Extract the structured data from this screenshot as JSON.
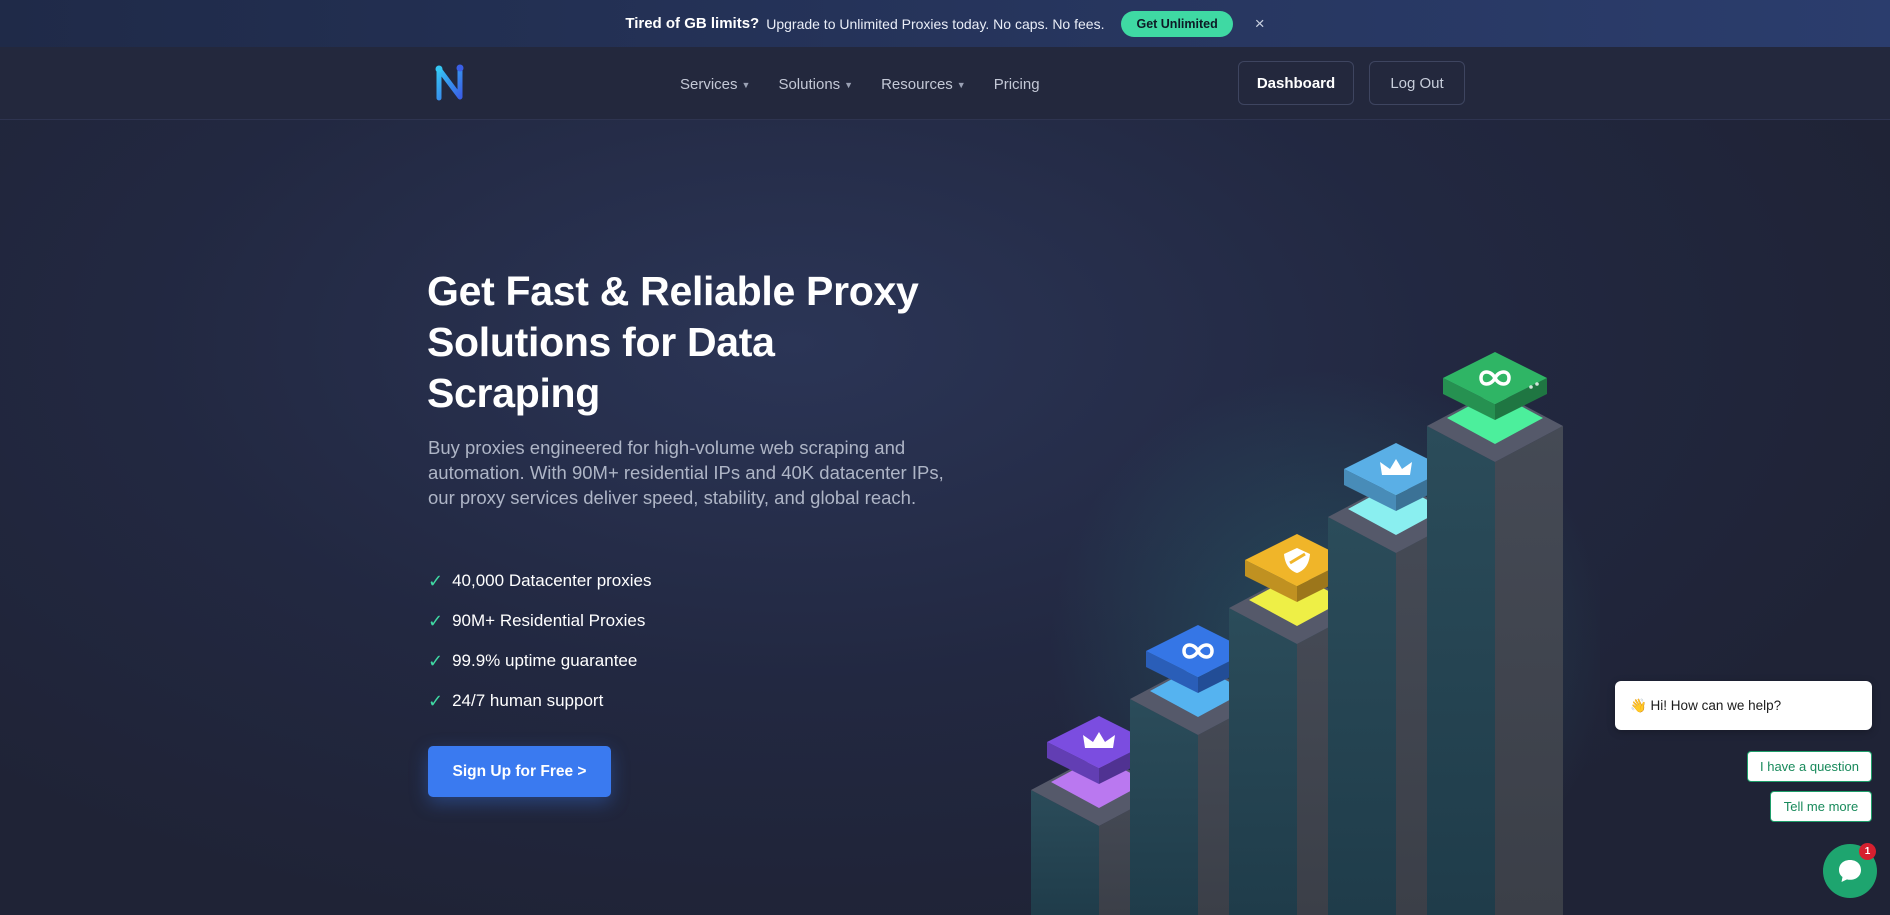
{
  "banner": {
    "headline": "Tired of GB limits?",
    "message": "Upgrade to Unlimited Proxies today. No caps. No fees.",
    "button_label": "Get Unlimited",
    "close_glyph": "×",
    "colors": {
      "background": "#27365f",
      "button": "#3fd9a3"
    }
  },
  "header": {
    "logo_icon": "n-logo-icon",
    "nav": [
      {
        "label": "Services",
        "dropdown": true
      },
      {
        "label": "Solutions",
        "dropdown": true
      },
      {
        "label": "Resources",
        "dropdown": true
      },
      {
        "label": "Pricing",
        "dropdown": false
      }
    ],
    "dashboard_label": "Dashboard",
    "logout_label": "Log Out"
  },
  "hero": {
    "title_lines": [
      "Get Fast & Reliable Proxy",
      "Solutions for Data",
      "Scraping"
    ],
    "description": "Buy proxies engineered for high-volume web scraping and automation. With 90M+ residential IPs and 40K datacenter IPs, our proxy services deliver speed, stability, and global reach.",
    "features": [
      "40,000 Datacenter proxies",
      "90M+ Residential Proxies",
      "99.9% uptime guarantee",
      "24/7 human support"
    ],
    "check_glyph": "✓",
    "cta_label": "Sign Up for Free >",
    "colors": {
      "accent": "#3a7af0",
      "check": "#3fd9a3"
    }
  },
  "illustration": {
    "steps": [
      {
        "icon": "crown-icon",
        "color": "#7b4de0"
      },
      {
        "icon": "infinity-icon",
        "color": "#3576e6"
      },
      {
        "icon": "shield-icon",
        "color": "#f0b529"
      },
      {
        "icon": "crown-icon",
        "color": "#5aafe6"
      },
      {
        "icon": "infinity-icon",
        "color": "#2fb565"
      }
    ]
  },
  "chat": {
    "greeting": "👋 Hi! How can we help?",
    "options": [
      "I have a question",
      "Tell me more"
    ],
    "badge_count": "1",
    "colors": {
      "launcher": "#1ea56f",
      "badge": "#d6202f"
    }
  }
}
